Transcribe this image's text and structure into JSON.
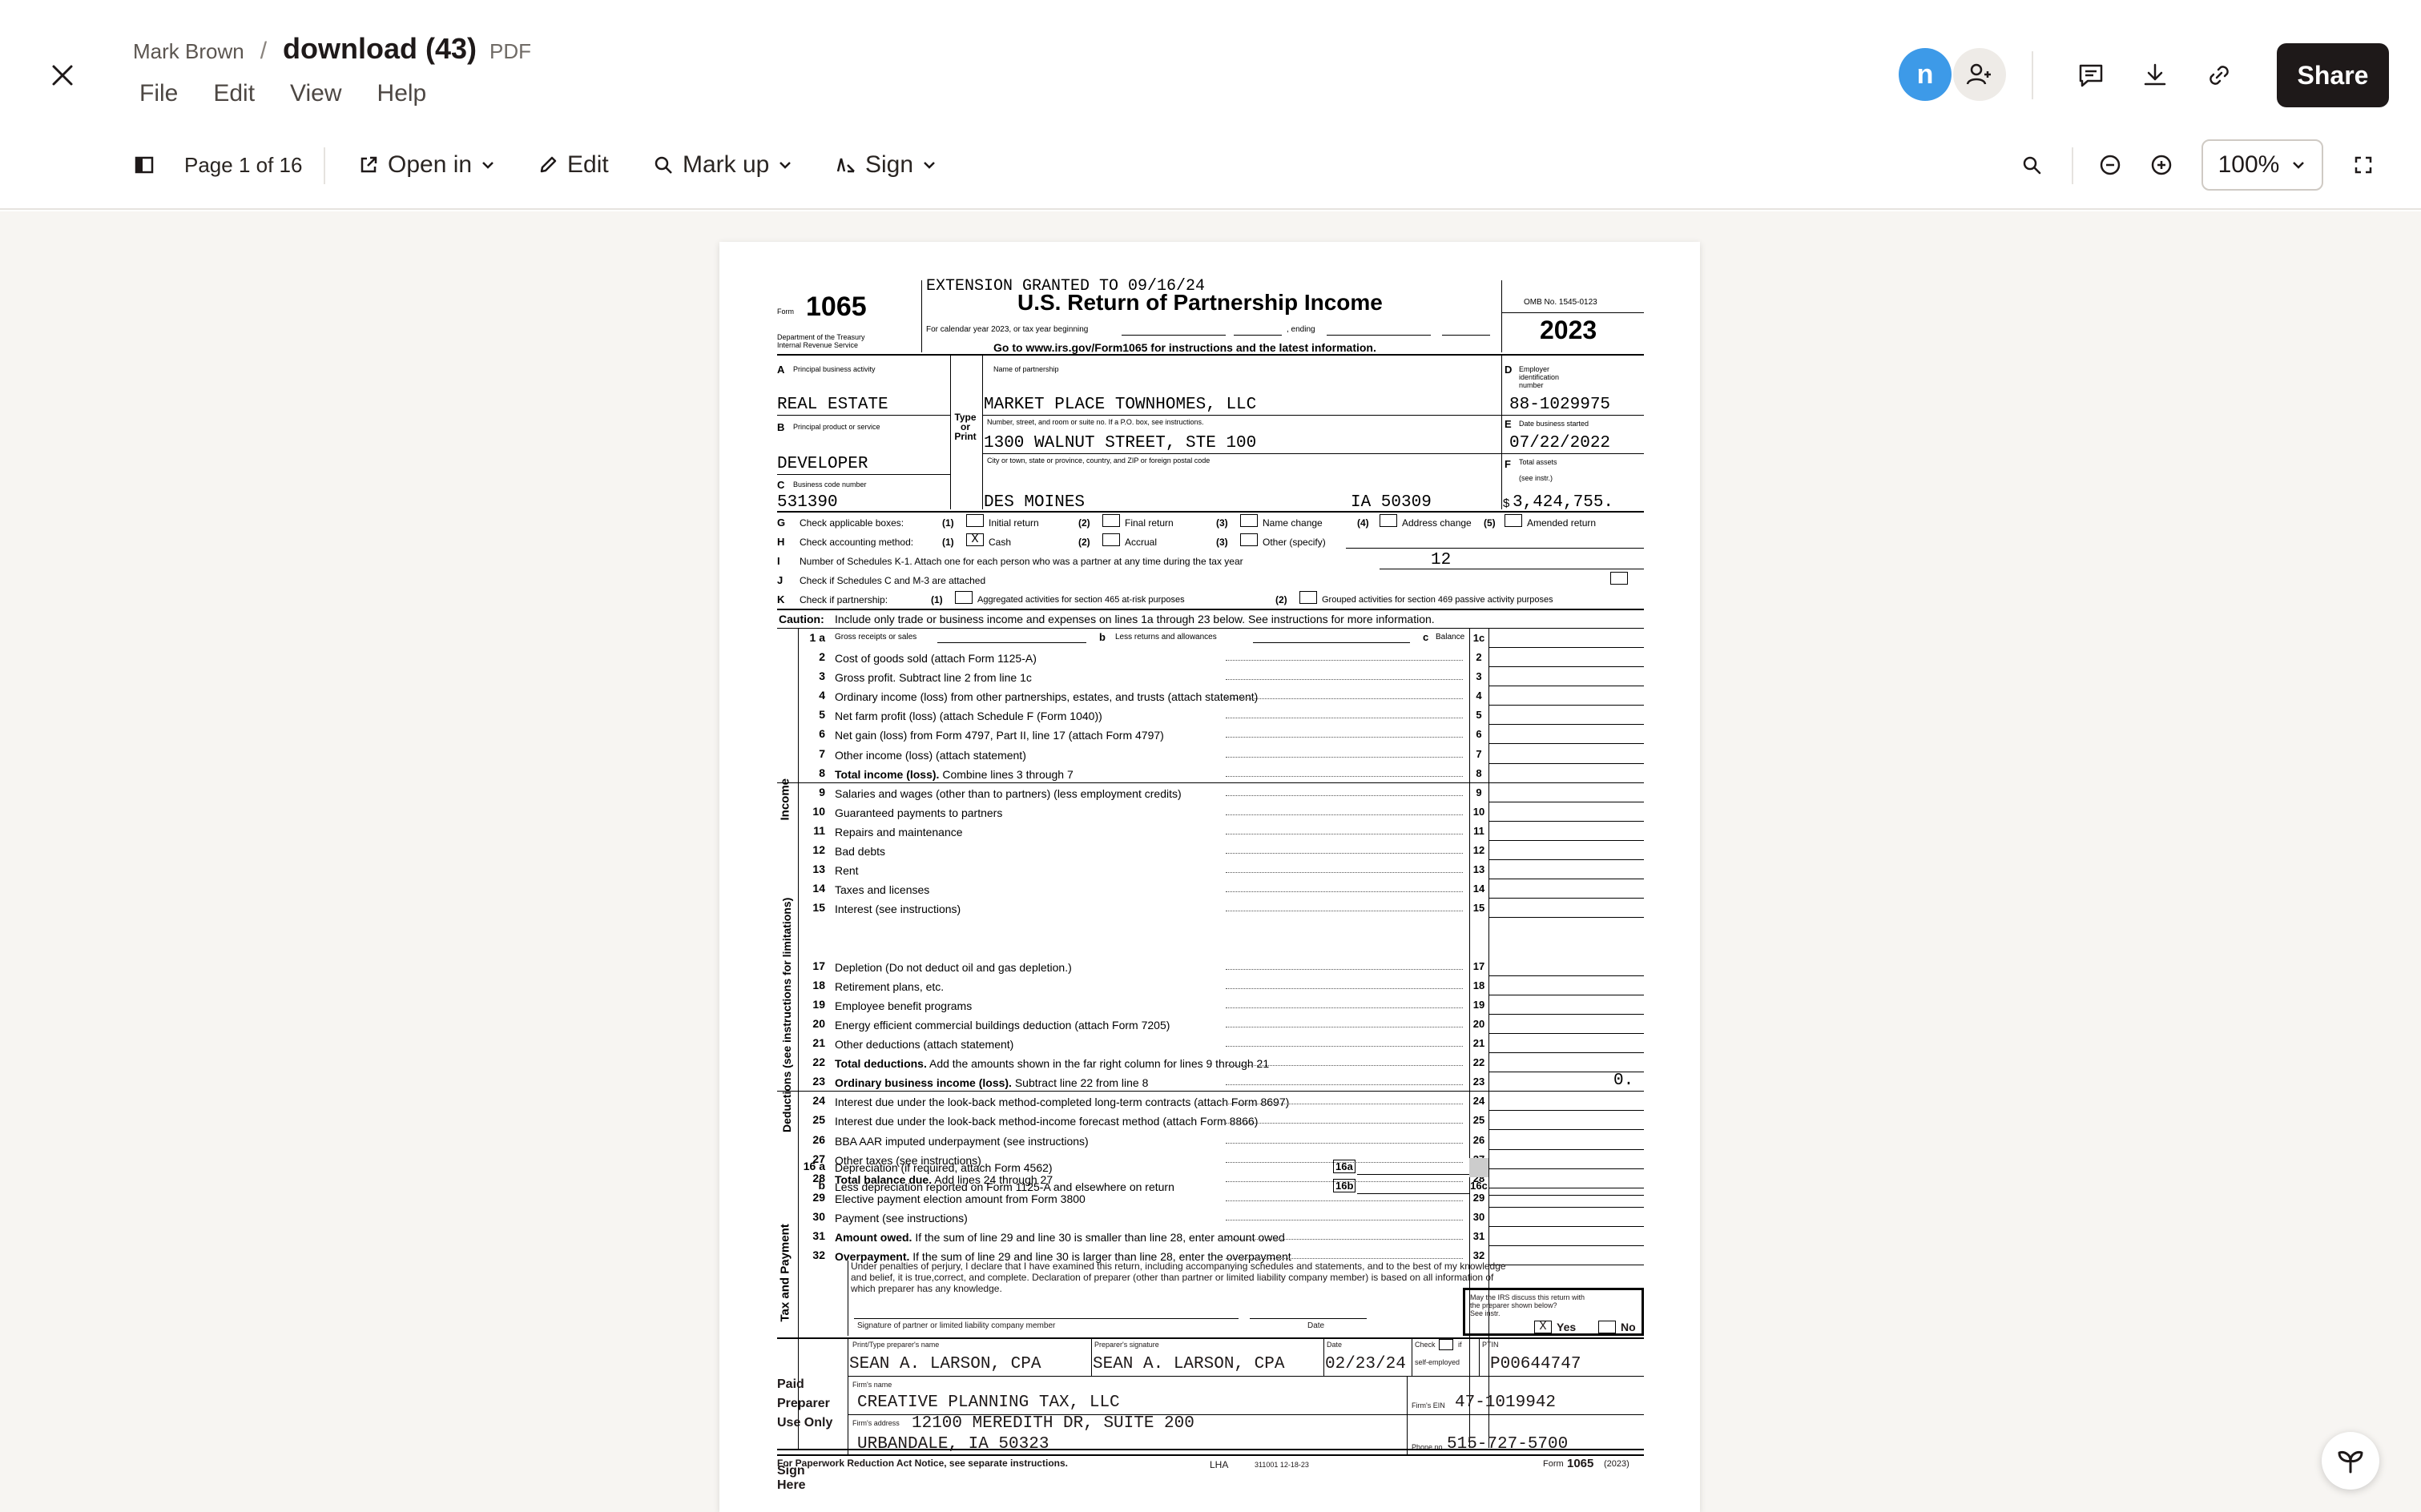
{
  "header": {
    "owner": "Mark Brown",
    "separator": "/",
    "file_name": "download (43)",
    "file_type": "PDF",
    "menu": [
      "File",
      "Edit",
      "View",
      "Help"
    ],
    "avatar_initial": "n",
    "share_label": "Share"
  },
  "toolbar": {
    "page_indicator": "Page 1 of 16",
    "open_in": "Open in",
    "edit": "Edit",
    "mark_up": "Mark up",
    "sign": "Sign",
    "zoom": "100%"
  },
  "form": {
    "extension": "EXTENSION GRANTED TO 09/16/24",
    "form_label": "Form",
    "form_number": "1065",
    "dept": "Department of the Treasury",
    "irs": "Internal Revenue Service",
    "title": "U.S. Return of Partnership Income",
    "calendar_line": "For calendar year 2023, or tax year beginning",
    "ending": ", ending",
    "goto": "Go to www.irs.gov/Form1065 for instructions and the latest information.",
    "omb": "OMB No. 1545-0123",
    "year": "2023",
    "a_label": "A",
    "a_text": "Principal business activity",
    "a_value": "REAL ESTATE",
    "b_label": "B",
    "b_text": "Principal product or service",
    "b_value": "DEVELOPER",
    "c_label": "C",
    "c_text": "Business code number",
    "c_value": "531390",
    "type_or_print": [
      "Type",
      "or",
      "Print"
    ],
    "name_label": "Name of partnership",
    "name_value": "MARKET PLACE TOWNHOMES, LLC",
    "street_label": "Number, street, and room or suite no. If a P.O. box, see instructions.",
    "street_value": "1300 WALNUT STREET, STE 100",
    "city_label": "City or town, state or province, country, and ZIP or foreign postal code",
    "city_value": "DES MOINES",
    "state_zip": "IA 50309",
    "d_label": "D",
    "d_text": "Employer identification number",
    "d_value": "88-1029975",
    "e_label": "E",
    "e_text": "Date business started",
    "e_value": "07/22/2022",
    "f_label": "F",
    "f_text": "Total assets",
    "f_text2": "(see instr.)",
    "f_dollar": "$",
    "f_value": "3,424,755.",
    "g_text": "Check applicable boxes:",
    "g_opts": [
      "(1)",
      "Initial return",
      "(2)",
      "Final return",
      "(3)",
      "Name change",
      "(4)",
      "Address change",
      "(5)",
      "Amended return"
    ],
    "h_text": "Check accounting method:",
    "h_opts": [
      "(1)",
      "Cash",
      "(2)",
      "Accrual",
      "(3)",
      "Other (specify)"
    ],
    "h_mark": "X",
    "i_text": "Number of Schedules K-1. Attach one for each person who was a partner at any time during the tax year",
    "i_value": "12",
    "j_text": "Check if Schedules C and M-3 are attached",
    "k_text": "Check if partnership:",
    "k_opts": [
      "(1)",
      "Aggregated activities for section 465 at-risk purposes",
      "(2)",
      "Grouped activities for section 469 passive activity purposes"
    ],
    "caution": "Caution:",
    "caution_text": "Include only trade or business income and expenses on lines 1a through 23 below. See instructions for more information.",
    "line1a": {
      "num": "1 a",
      "text": "Gross receipts or sales",
      "b": "b",
      "b_text": "Less returns and allowances",
      "c": "c",
      "c_text": "Balance",
      "col": "1c"
    },
    "income_lines": [
      {
        "num": "2",
        "text": "Cost of goods sold (attach Form 1125-A)",
        "col": "2"
      },
      {
        "num": "3",
        "text": "Gross profit. Subtract line 2 from line 1c",
        "col": "3"
      },
      {
        "num": "4",
        "text": "Ordinary income (loss) from other partnerships, estates, and trusts (attach statement)",
        "col": "4"
      },
      {
        "num": "5",
        "text": "Net farm profit (loss) (attach Schedule F (Form 1040))",
        "col": "5"
      },
      {
        "num": "6",
        "text": "Net gain (loss) from Form 4797, Part II, line 17 (attach Form 4797)",
        "col": "6"
      },
      {
        "num": "7",
        "text": "Other income (loss) (attach statement)",
        "col": "7"
      },
      {
        "num": "8",
        "text": "Total income (loss). Combine lines 3 through 7",
        "col": "8"
      }
    ],
    "deduction_lines": [
      {
        "num": "9",
        "text": "Salaries and wages (other than to partners) (less employment credits)",
        "col": "9"
      },
      {
        "num": "10",
        "text": "Guaranteed payments to partners",
        "col": "10"
      },
      {
        "num": "11",
        "text": "Repairs and maintenance",
        "col": "11"
      },
      {
        "num": "12",
        "text": "Bad debts",
        "col": "12"
      },
      {
        "num": "13",
        "text": "Rent",
        "col": "13"
      },
      {
        "num": "14",
        "text": "Taxes and licenses",
        "col": "14"
      },
      {
        "num": "15",
        "text": "Interest (see instructions)",
        "col": "15"
      }
    ],
    "line16a": {
      "num": "16 a",
      "text": "Depreciation (if required, attach Form 4562)",
      "box": "16a"
    },
    "line16b": {
      "num": "b",
      "text": "Less depreciation reported on Form 1125-A and elsewhere on return",
      "box": "16b",
      "col": "16c"
    },
    "deduction_lines2": [
      {
        "num": "17",
        "text": "Depletion (Do not deduct oil and gas depletion.)",
        "col": "17"
      },
      {
        "num": "18",
        "text": "Retirement plans, etc.",
        "col": "18"
      },
      {
        "num": "19",
        "text": "Employee benefit programs",
        "col": "19"
      },
      {
        "num": "20",
        "text": "Energy efficient commercial buildings deduction (attach Form 7205)",
        "col": "20"
      },
      {
        "num": "21",
        "text": "Other deductions (attach statement)",
        "col": "21"
      },
      {
        "num": "22",
        "text": "Total deductions. Add the amounts shown in the far right column for lines 9 through 21",
        "col": "22"
      }
    ],
    "line23": {
      "num": "23",
      "text": "Ordinary business income (loss). Subtract line 22 from line 8",
      "col": "23",
      "value": "0."
    },
    "tax_lines": [
      {
        "num": "24",
        "text": "Interest due under the look-back method-completed long-term contracts (attach Form 8697)",
        "col": "24"
      },
      {
        "num": "25",
        "text": "Interest due under the look-back method-income forecast method (attach Form 8866)",
        "col": "25"
      },
      {
        "num": "26",
        "text": "BBA AAR imputed underpayment (see instructions)",
        "col": "26"
      },
      {
        "num": "27",
        "text": "Other taxes (see instructions)",
        "col": "27"
      },
      {
        "num": "28",
        "text": "Total balance due. Add lines 24 through 27",
        "col": "28"
      },
      {
        "num": "29",
        "text": "Elective payment election amount from Form 3800",
        "col": "29"
      },
      {
        "num": "30",
        "text": "Payment (see instructions)",
        "col": "30"
      },
      {
        "num": "31",
        "text": "Amount owed. If the sum of line 29 and line 30 is smaller than line 28, enter amount owed",
        "col": "31"
      },
      {
        "num": "32",
        "text": "Overpayment. If the sum of line 29 and line 30 is larger than line 28, enter the overpayment",
        "col": "32"
      }
    ],
    "income_side": "Income",
    "deductions_side": "Deductions (see instructions for limitations)",
    "tax_side": "Tax and Payment",
    "sign_here": [
      "Sign",
      "Here"
    ],
    "perjury": [
      "Under penalties of perjury, I declare that I have examined this return, including accompanying schedules and statements, and to the best of my knowledge",
      "and belief, it is true,correct, and complete. Declaration of preparer (other than partner or limited liability company member) is based on all information of",
      "which preparer has any knowledge."
    ],
    "irs_discuss": [
      "May the IRS discuss this return with",
      "the preparer shown below?",
      "See instr."
    ],
    "yes_mark": "X",
    "yes": "Yes",
    "no": "No",
    "sig_label": "Signature of partner or limited liability company member",
    "date_label": "Date",
    "paid_preparer": [
      "Paid",
      "Preparer",
      "Use Only"
    ],
    "prep_name_label": "Print/Type preparer's name",
    "prep_name": "SEAN A. LARSON, CPA",
    "prep_sig_label": "Preparer's signature",
    "prep_sig": "SEAN A. LARSON, CPA",
    "prep_date_label": "Date",
    "prep_date": "02/23/24",
    "check_label": "Check",
    "if_label": "if",
    "self_emp": "self-employed",
    "ptin_label": "PTIN",
    "ptin": "P00644747",
    "firm_name_label": "Firm's name",
    "firm_name": "CREATIVE PLANNING TAX, LLC",
    "firm_ein_label": "Firm's EIN",
    "firm_ein": "47-1019942",
    "firm_addr_label": "Firm's address",
    "firm_addr1": "12100 MEREDITH DR, SUITE 200",
    "firm_addr2": "URBANDALE, IA 50323",
    "phone_label": "Phone no.",
    "phone": "515-727-5700",
    "footer_left": "For Paperwork Reduction Act Notice, see separate instructions.",
    "footer_lha": "LHA",
    "footer_code": "311001  12-18-23",
    "footer_form": "Form",
    "footer_num": "1065",
    "footer_year": "(2023)"
  }
}
